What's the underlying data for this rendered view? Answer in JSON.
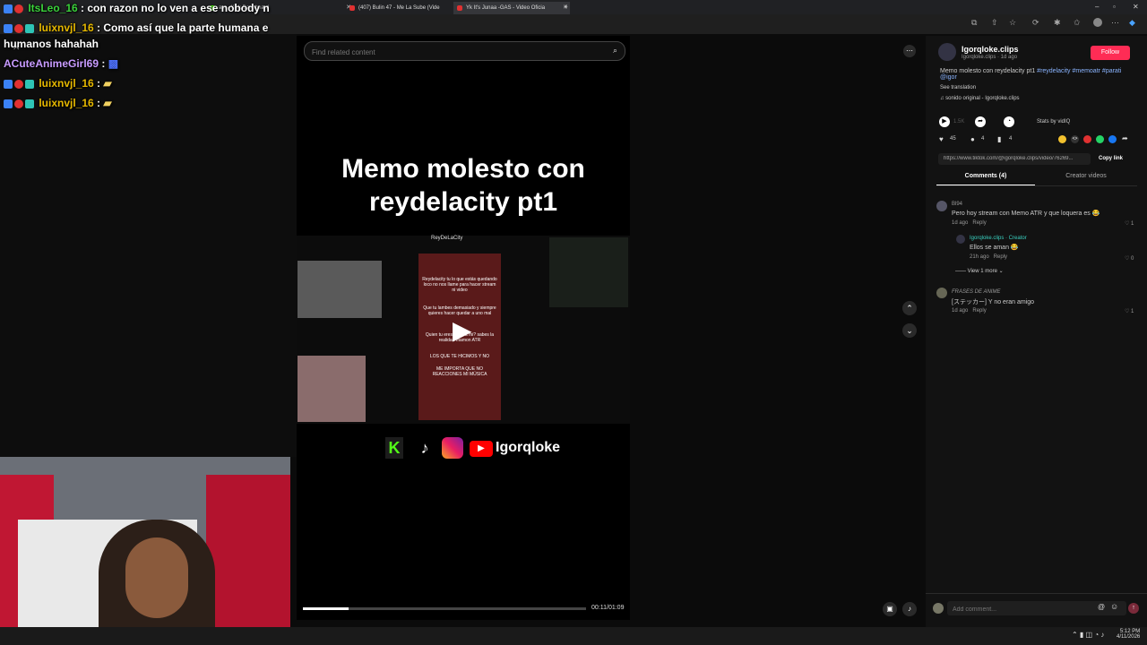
{
  "browser": {
    "tabs": [
      {
        "label": "am - Kick Dashboard"
      },
      {
        "label": "(407) Bulin 47 - Me La Sube (Vide"
      },
      {
        "label": "Yk It's Junaa -GAS - Video Oficia"
      }
    ]
  },
  "chat": {
    "messages": [
      {
        "user": "ItsLeo_16",
        "text": "con razon no lo ven a ese nobody n",
        "color": "#3ad13a"
      },
      {
        "user": "luixnvjl_16",
        "text": "Como así que la parte humana e",
        "color": "#e6b800"
      },
      {
        "user": "",
        "text": "humanos hahahah",
        "color": "#ffffff"
      },
      {
        "user": "ACuteAnimeGirl69",
        "text": "",
        "color": "#c89bff"
      },
      {
        "user": "luixnvjl_16",
        "text": "",
        "color": "#e6b800"
      },
      {
        "user": "luixnvjl_16",
        "text": "",
        "color": "#e6b800"
      }
    ]
  },
  "video": {
    "search_placeholder": "Find related content",
    "title": "Memo molesto con reydelacity pt1",
    "channel_header": "ReyDeLaCity",
    "brand": "Igorqloke",
    "progress": 0.16,
    "time": "00:11/01:09",
    "screen_text": [
      "Reydelacity tu lo que estás quedando loco no nos llame para hacer stream ni video",
      "Que tu lambes demasiado y siempre quieres hacer quedar a uno mal",
      "Quien tu eres pa ... a mi? sabes la realidad mamon ATR",
      "LOS QUE TE HICIMOS Y NO",
      "ME IMPORTA QUE NO REACCIONES MI MÚSICA"
    ]
  },
  "profile": {
    "name": "Igorqloke.clips",
    "sub": "Igorqloke.clips · 1d ago",
    "follow": "Follow",
    "caption": "Memo molesto con reydelacity pt1",
    "hashtags": "#reydelacity #memoatr #parati @igor",
    "see_translation": "See translation",
    "sound": "sonido original - Igorqloke.clips",
    "plays": "1.5K",
    "stats_by": "Stats by vidIQ",
    "likes": "45",
    "comments_count": "4",
    "saves": "4",
    "link": "https://www.tiktok.com/@igorqloke.clips/video/76269...",
    "copy_link": "Copy link",
    "tab_comments": "Comments (4)",
    "tab_creator": "Creator videos"
  },
  "comments": [
    {
      "user": "Bl94",
      "text": "Pero hoy stream con Memo ATR y que loquera es 😂",
      "time": "1d ago",
      "reply": "Reply",
      "likes": "1"
    },
    {
      "user": "Igorqloke.clips · Creator",
      "text": "Ellos se aman 😂",
      "time": "21h ago",
      "reply": "Reply",
      "likes": "0"
    },
    {
      "user": "FRASES DE ANIME",
      "text": "[ステッカー] Y no eran amigo",
      "time": "1d ago",
      "reply": "Reply",
      "likes": "1"
    }
  ],
  "view_more": "View 1 more",
  "add_comment_placeholder": "Add comment...",
  "clock": {
    "time": "5:12 PM",
    "date": "4/11/2026"
  }
}
